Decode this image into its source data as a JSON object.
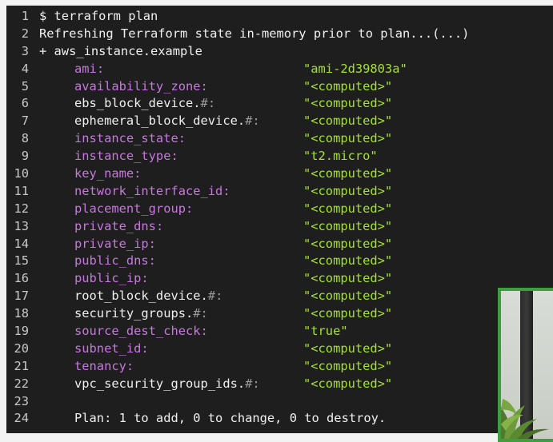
{
  "editor": {
    "lines": [
      {
        "n": "1",
        "type": "text",
        "text": "$ terraform plan"
      },
      {
        "n": "2",
        "type": "text",
        "text": "Refreshing Terraform state in-memory prior to plan...(...)"
      },
      {
        "n": "3",
        "type": "text",
        "text": "+ aws_instance.example"
      },
      {
        "n": "4",
        "type": "attr",
        "key": "ami",
        "hash": "",
        "style": "purple",
        "value": "\"ami-2d39803a\""
      },
      {
        "n": "5",
        "type": "attr",
        "key": "availability_zone",
        "hash": "",
        "style": "purple",
        "value": "\"<computed>\""
      },
      {
        "n": "6",
        "type": "attr",
        "key": "ebs_block_device.",
        "hash": "#",
        "style": "white",
        "value": "\"<computed>\""
      },
      {
        "n": "7",
        "type": "attr",
        "key": "ephemeral_block_device.",
        "hash": "#",
        "style": "white",
        "value": "\"<computed>\""
      },
      {
        "n": "8",
        "type": "attr",
        "key": "instance_state",
        "hash": "",
        "style": "purple",
        "value": "\"<computed>\""
      },
      {
        "n": "9",
        "type": "attr",
        "key": "instance_type",
        "hash": "",
        "style": "purple",
        "value": "\"t2.micro\""
      },
      {
        "n": "10",
        "type": "attr",
        "key": "key_name",
        "hash": "",
        "style": "purple",
        "value": "\"<computed>\""
      },
      {
        "n": "11",
        "type": "attr",
        "key": "network_interface_id",
        "hash": "",
        "style": "purple",
        "value": "\"<computed>\""
      },
      {
        "n": "12",
        "type": "attr",
        "key": "placement_group",
        "hash": "",
        "style": "purple",
        "value": "\"<computed>\""
      },
      {
        "n": "13",
        "type": "attr",
        "key": "private_dns",
        "hash": "",
        "style": "purple",
        "value": "\"<computed>\""
      },
      {
        "n": "14",
        "type": "attr",
        "key": "private_ip",
        "hash": "",
        "style": "purple",
        "value": "\"<computed>\""
      },
      {
        "n": "15",
        "type": "attr",
        "key": "public_dns",
        "hash": "",
        "style": "purple",
        "value": "\"<computed>\""
      },
      {
        "n": "16",
        "type": "attr",
        "key": "public_ip",
        "hash": "",
        "style": "purple",
        "value": "\"<computed>\""
      },
      {
        "n": "17",
        "type": "attr",
        "key": "root_block_device.",
        "hash": "#",
        "style": "white",
        "value": "\"<computed>\""
      },
      {
        "n": "18",
        "type": "attr",
        "key": "security_groups.",
        "hash": "#",
        "style": "white",
        "value": "\"<computed>\""
      },
      {
        "n": "19",
        "type": "attr",
        "key": "source_dest_check",
        "hash": "",
        "style": "purple",
        "value": "\"true\""
      },
      {
        "n": "20",
        "type": "attr",
        "key": "subnet_id",
        "hash": "",
        "style": "purple",
        "value": "\"<computed>\""
      },
      {
        "n": "21",
        "type": "attr",
        "key": "tenancy",
        "hash": "",
        "style": "purple",
        "value": "\"<computed>\""
      },
      {
        "n": "22",
        "type": "attr",
        "key": "vpc_security_group_ids.",
        "hash": "#",
        "style": "white",
        "value": "\"<computed>\""
      },
      {
        "n": "23",
        "type": "blank",
        "text": ""
      },
      {
        "n": "24",
        "type": "summary",
        "text": "Plan: 1 to add, 0 to change, 0 to destroy."
      }
    ]
  },
  "colors": {
    "editor_background": "#1e1e1e",
    "attribute_key": "#c679dd",
    "string_value": "#a6e22e",
    "line_number": "#c8c8c8",
    "video_border": "#3f9e3f"
  }
}
